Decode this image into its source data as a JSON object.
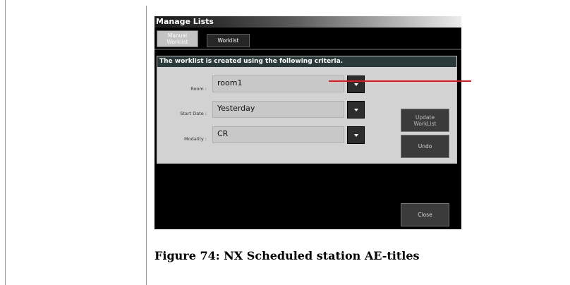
{
  "window": {
    "title": "Manage Lists"
  },
  "tabs": [
    {
      "label": "Manual\nWorklist"
    },
    {
      "label": "Worklist"
    }
  ],
  "panel": {
    "header": "The worklist is created using the following criteria.",
    "fields": [
      {
        "label": "Room :",
        "value": "room1"
      },
      {
        "label": "Start Date :",
        "value": "Yesterday"
      },
      {
        "label": "Modality :",
        "value": "CR"
      }
    ]
  },
  "buttons": {
    "update": "Update\nWorkList",
    "undo": "Undo",
    "close": "Close"
  },
  "caption": "Figure 74: NX Scheduled station AE-titles",
  "colors": {
    "annotation_line": "#e3161c"
  }
}
